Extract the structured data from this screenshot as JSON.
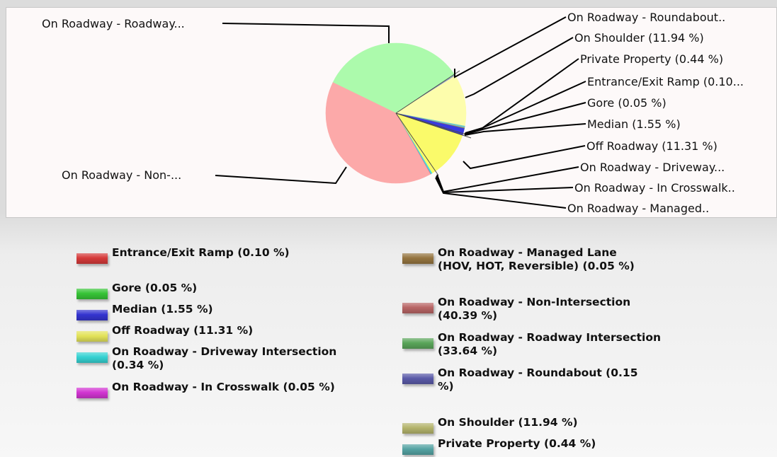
{
  "chart_data": {
    "type": "pie",
    "slices": [
      {
        "name": "On Roadway - Roadway Intersection",
        "value": 33.64,
        "color": "#acfaac",
        "callout": "On Roadway - Roadway...",
        "legend": "On Roadway - Roadway Intersection (33.64 %)",
        "legend_color": "#5aa55a"
      },
      {
        "name": "On Roadway - Roundabout",
        "value": 0.15,
        "color": "#7f7fd0",
        "callout": "On Roadway - Roundabout..",
        "legend": "On Roadway - Roundabout (0.15 %)",
        "legend_color": "#5a5aa8"
      },
      {
        "name": "On Shoulder",
        "value": 11.94,
        "color": "#fdfdac",
        "callout": "On Shoulder (11.94 %)",
        "legend": "On Shoulder (11.94 %)",
        "legend_color": "#b4b46c"
      },
      {
        "name": "Private Property",
        "value": 0.44,
        "color": "#6cc9c9",
        "callout": "Private Property (0.44 %)",
        "legend": "Private Property (0.44 %)",
        "legend_color": "#55a3a3"
      },
      {
        "name": "Entrance/Exit Ramp",
        "value": 0.1,
        "color": "#e05050",
        "callout": "Entrance/Exit Ramp (0.10...",
        "legend": "Entrance/Exit Ramp (0.10 %)",
        "legend_color": "#d53a3a"
      },
      {
        "name": "Gore",
        "value": 0.05,
        "color": "#40d040",
        "callout": "Gore (0.05 %)",
        "legend": "Gore (0.05 %)",
        "legend_color": "#37c437"
      },
      {
        "name": "Median",
        "value": 1.55,
        "color": "#3a3ae0",
        "callout": "Median (1.55 %)",
        "legend": "Median (1.55 %)",
        "legend_color": "#3434d0"
      },
      {
        "name": "Off Roadway",
        "value": 11.31,
        "color": "#fafa6a",
        "callout": "Off Roadway (11.31 %)",
        "legend": "Off Roadway (11.31 %)",
        "legend_color": "#e3e35a"
      },
      {
        "name": "On Roadway - Driveway Intersection",
        "value": 0.34,
        "color": "#40e0e0",
        "callout": "On Roadway - Driveway...",
        "legend": "On Roadway - Driveway Intersection (0.34 %)",
        "legend_color": "#35d2d2"
      },
      {
        "name": "On Roadway - In Crosswalk",
        "value": 0.05,
        "color": "#e040e0",
        "callout": "On Roadway - In Crosswalk..",
        "legend": "On Roadway - In Crosswalk (0.05 %)",
        "legend_color": "#d235d2"
      },
      {
        "name": "On Roadway - Managed Lane (HOV, HOT, Reversible)",
        "value": 0.05,
        "color": "#a08040",
        "callout": "On Roadway - Managed..",
        "legend": "On Roadway - Managed Lane (HOV, HOT, Reversible) (0.05 %)",
        "legend_color": "#957540"
      },
      {
        "name": "On Roadway - Non-Intersection",
        "value": 40.39,
        "color": "#fca9a9",
        "callout": "On Roadway - Non-...",
        "legend": "On Roadway - Non-Intersection (40.39 %)",
        "legend_color": "#b86565"
      }
    ],
    "legend_placement": "bottom",
    "title": ""
  }
}
